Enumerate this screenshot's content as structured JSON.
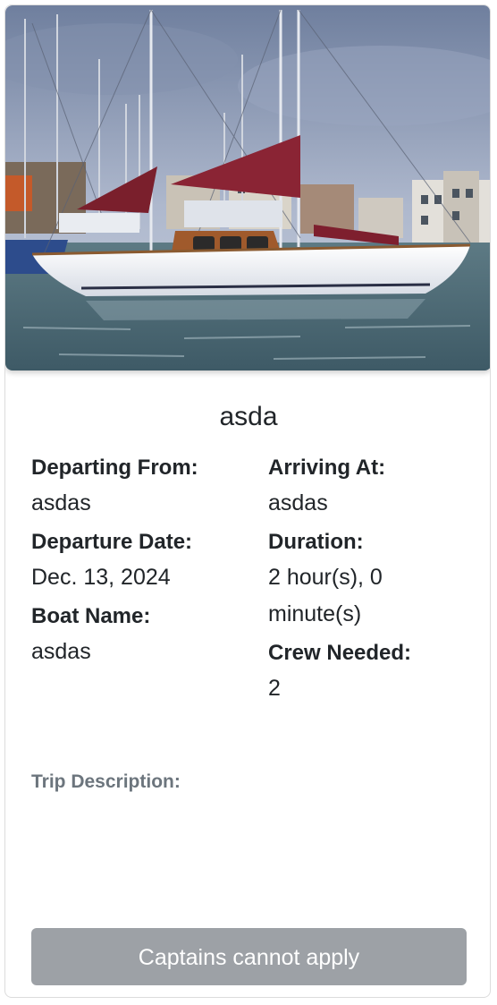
{
  "trip": {
    "title": "asda",
    "departing_from_label": "Departing From:",
    "departing_from": "asdas",
    "arriving_at_label": "Arriving At:",
    "arriving_at": "asdas",
    "departure_date_label": "Departure Date:",
    "departure_date": "Dec. 13, 2024",
    "duration_label": "Duration:",
    "duration": "2 hour(s), 0 minute(s)",
    "boat_name_label": "Boat Name:",
    "boat_name": "asdas",
    "crew_needed_label": "Crew Needed:",
    "crew_needed": "2",
    "description_label": "Trip Description:",
    "description": ""
  },
  "apply_button": {
    "label": "Captains cannot apply",
    "disabled": true
  },
  "colors": {
    "button_bg": "#9da1a6",
    "muted_text": "#6c757d",
    "text": "#212529"
  }
}
